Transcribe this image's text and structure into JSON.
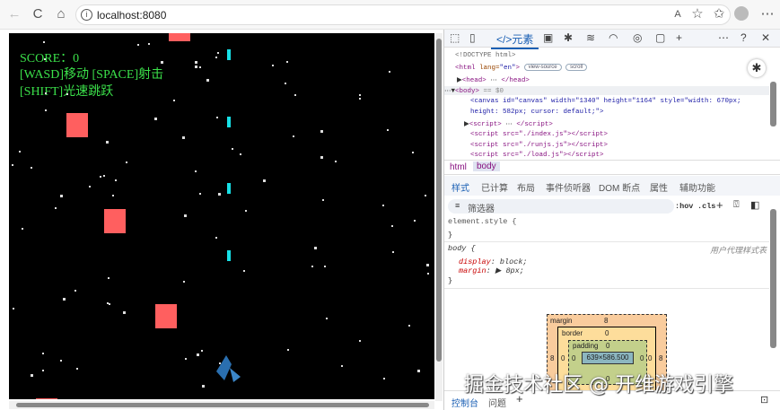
{
  "browser": {
    "url": "localhost:8080",
    "back": "←",
    "reload": "C",
    "home": "⌂"
  },
  "game": {
    "score": "SCORE：0",
    "hint1": "[WASD]移动 [SPACE]射击",
    "hint2": "[SHIFT]光速跳跃"
  },
  "devtools": {
    "tabs": {
      "elements": "</>元素"
    },
    "dom": {
      "doctype": "<!DOCTYPE html>",
      "html_open": "<html",
      "lang_attr": " lang=",
      "lang_val": "\"en\"",
      "view_source": "view-source",
      "scroll": "scroll",
      "head": "<head>",
      "head_close": "</head>",
      "body": "<body>",
      "body_eq": " == $0",
      "canvas_line1": "<canvas id=\"canvas\" width=\"1340\" height=\"1164\" style=\"width: 670px;",
      "canvas_line2": "height: 582px; cursor: default;\">",
      "script1": "<script>",
      "script1_close": "</script>",
      "script2": "<script src=\"./index.js\"></script>",
      "script3": "<script src=\"./runjs.js\"></script>",
      "script4": "<script src=\"./load.js\"></script>"
    },
    "breadcrumb": [
      "html",
      "body"
    ],
    "subtabs": [
      "样式",
      "已计算",
      "布局",
      "事件侦听器",
      "DOM 断点",
      "属性",
      "辅助功能"
    ],
    "filter_placeholder": "筛选器",
    "filter_tools": {
      "hov": ":hov",
      "cls": ".cls"
    },
    "styles": {
      "element_style": "element.style {",
      "close": "}",
      "body_sel": "body {",
      "ua_label": "用户代理样式表",
      "display": "display",
      "display_val": "block;",
      "margin": "margin",
      "margin_val": "8px;"
    },
    "boxmodel": {
      "margin_label": "margin",
      "margin": "8",
      "border_label": "border",
      "border": "0",
      "padding_label": "padding",
      "padding": "0",
      "size": "639×586.500",
      "left_margin": "8",
      "right_margin": "8",
      "left_border": "0",
      "right_border": "0",
      "left_padding": "0",
      "right_padding": "0",
      "bottom_padding": "0"
    },
    "drawer_tabs": [
      "控制台",
      "问题"
    ]
  },
  "watermark": "掘金技术社区 @ 开维游戏引擎"
}
